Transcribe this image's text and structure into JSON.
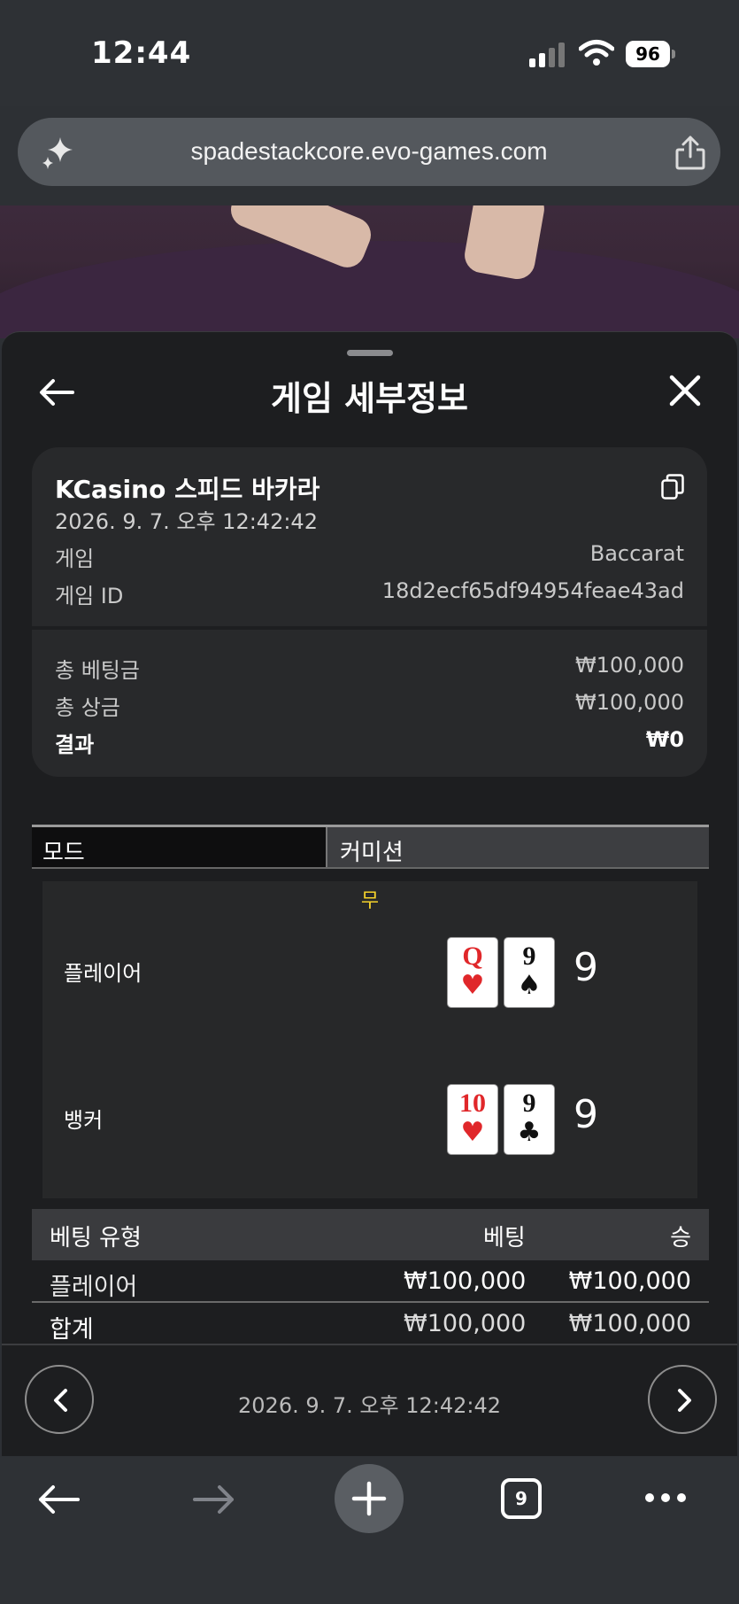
{
  "status_bar": {
    "time": "12:44",
    "battery": "96"
  },
  "browser": {
    "url": "spadestackcore.evo-games.com",
    "tab_count": "9"
  },
  "sheet": {
    "title": "게임 세부정보",
    "game_name": "KCasino 스피드 바카라",
    "datetime": "2026. 9. 7. 오후 12:42:42",
    "details": [
      {
        "label": "게임",
        "value": "Baccarat"
      },
      {
        "label": "게임 ID",
        "value": "18d2ecf65df94954feae43ad"
      }
    ],
    "totals": {
      "total_bet_label": "총 베팅금",
      "total_bet_value": "₩100,000",
      "total_prize_label": "총 상금",
      "total_prize_value": "₩100,000",
      "result_label": "결과",
      "result_value": "₩0"
    },
    "mode": {
      "label": "모드",
      "value": "커미션"
    },
    "outcome": {
      "tie_label": "무",
      "player": {
        "label": "플레이어",
        "cards": [
          {
            "rank": "Q",
            "suit": "♥"
          },
          {
            "rank": "9",
            "suit": "♠"
          }
        ],
        "score": "9"
      },
      "banker": {
        "label": "뱅커",
        "cards": [
          {
            "rank": "10",
            "suit": "♥"
          },
          {
            "rank": "9",
            "suit": "♣"
          }
        ],
        "score": "9"
      }
    },
    "bets": {
      "headers": {
        "type": "베팅 유형",
        "bet": "베팅",
        "win": "승"
      },
      "rows": [
        {
          "type": "플레이어",
          "bet": "₩100,000",
          "win": "₩100,000"
        }
      ],
      "total": {
        "type": "합계",
        "bet": "₩100,000",
        "win": "₩100,000"
      }
    },
    "footer_datetime": "2026. 9. 7. 오후 12:42:42"
  },
  "colors": {
    "accent_tie": "#f5d22a",
    "red_suit": "#e0272a",
    "sheet_bg": "#1d1e20"
  }
}
